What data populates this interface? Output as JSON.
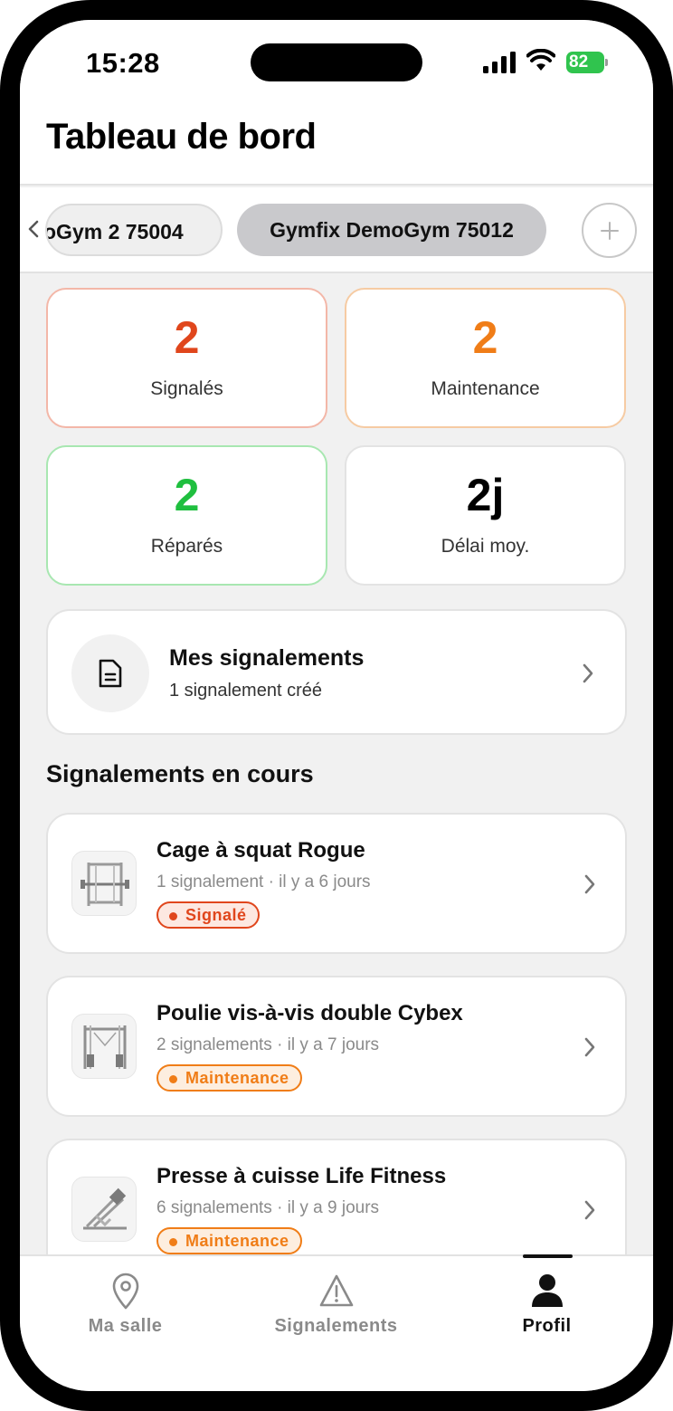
{
  "status_bar": {
    "time": "15:28",
    "battery": "82"
  },
  "header": {
    "title": "Tableau de bord"
  },
  "gyms": {
    "previous_label": "oGym 2 75004",
    "active_label": "Gymfix DemoGym 75012"
  },
  "stats": {
    "reported": {
      "value": "2",
      "label": "Signalés",
      "color": "#e0461c"
    },
    "maintenance": {
      "value": "2",
      "label": "Maintenance",
      "color": "#f07d17"
    },
    "repaired": {
      "value": "2",
      "label": "Réparés",
      "color": "#1fbf3f"
    },
    "delay": {
      "value": "2j",
      "label": "Délai moy.",
      "color": "#000000"
    }
  },
  "my_reports": {
    "title": "Mes signalements",
    "subtitle": "1 signalement créé"
  },
  "section": {
    "title": "Signalements en cours"
  },
  "reports": [
    {
      "title": "Cage à squat Rogue",
      "meta": "1 signalement · il y a 6 jours",
      "status": "Signalé",
      "thumbnail_icon": "squat-rack-icon"
    },
    {
      "title": "Poulie vis-à-vis double Cybex",
      "meta": "2 signalements · il y a 7 jours",
      "status": "Maintenance",
      "thumbnail_icon": "cable-crossover-icon"
    },
    {
      "title": "Presse à cuisse Life Fitness",
      "meta": "6 signalements · il y a 9 jours",
      "status": "Maintenance",
      "thumbnail_icon": "leg-press-icon"
    }
  ],
  "tabs": [
    {
      "label": "Ma salle",
      "icon": "location-pin-icon",
      "active": false
    },
    {
      "label": "Signalements",
      "icon": "warning-triangle-icon",
      "active": false
    },
    {
      "label": "Profil",
      "icon": "person-icon",
      "active": true
    }
  ]
}
